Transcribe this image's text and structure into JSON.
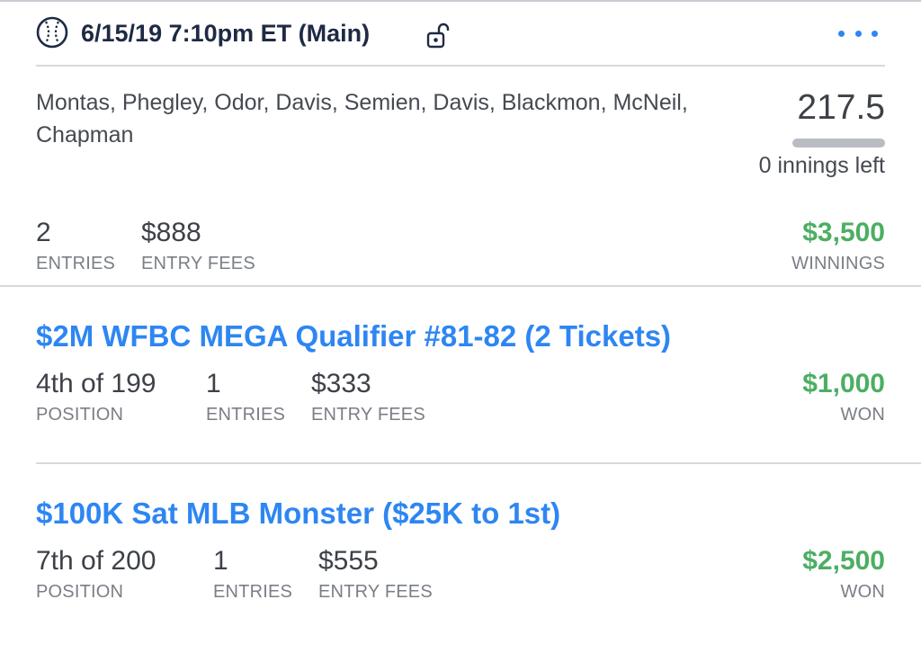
{
  "header": {
    "title": "6/15/19 7:10pm ET (Main)",
    "sport_icon": "baseball-icon",
    "lock_icon": "unlocked-lock-icon",
    "more_icon": "more-dots-icon"
  },
  "lineup": {
    "players": "Montas, Phegley, Odor, Davis, Semien, Davis, Blackmon, McNeil, Chapman",
    "score": "217.5",
    "progress_fraction": 1.0,
    "innings_left": "0 innings left"
  },
  "summary": {
    "entries_value": "2",
    "entries_label": "ENTRIES",
    "fees_value": "$888",
    "fees_label": "ENTRY FEES",
    "winnings_value": "$3,500",
    "winnings_label": "WINNINGS"
  },
  "contests": [
    {
      "title": "$2M WFBC MEGA Qualifier #81-82 (2 Tickets)",
      "position_value": "4th of 199",
      "position_label": "POSITION",
      "entries_value": "1",
      "entries_label": "ENTRIES",
      "fees_value": "$333",
      "fees_label": "ENTRY FEES",
      "won_value": "$1,000",
      "won_label": "WON"
    },
    {
      "title": "$100K Sat MLB Monster ($25K to 1st)",
      "position_value": "7th of 200",
      "position_label": "POSITION",
      "entries_value": "1",
      "entries_label": "ENTRIES",
      "fees_value": "$555",
      "fees_label": "ENTRY FEES",
      "won_value": "$2,500",
      "won_label": "WON"
    }
  ],
  "colors": {
    "accent_blue": "#2e86f2",
    "win_green": "#4cae63",
    "header_navy": "#1e2a44"
  }
}
